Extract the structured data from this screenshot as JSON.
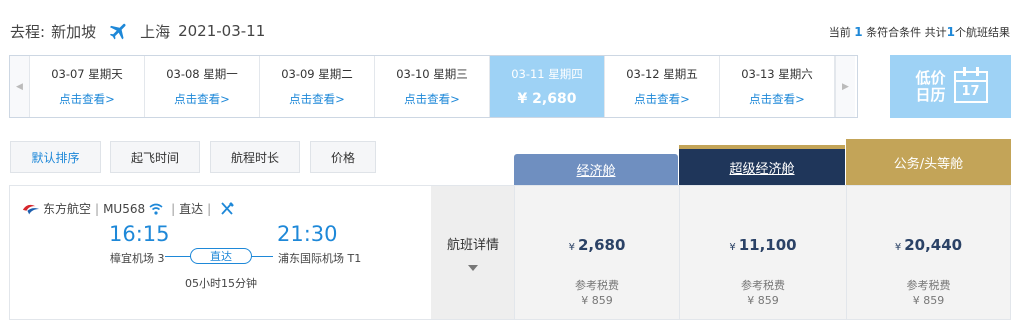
{
  "header": {
    "direction_label": "去程:",
    "from_city": "新加坡",
    "to_city": "上海",
    "date": "2021-03-11"
  },
  "result_summary": {
    "prefix": "当前",
    "match_count": "1",
    "match_text": "条符合条件 共计",
    "total_count": "1",
    "total_text": "个航班结果"
  },
  "date_strip": {
    "items": [
      {
        "date": "03-07 星期天",
        "value": "点击查看>"
      },
      {
        "date": "03-08 星期一",
        "value": "点击查看>"
      },
      {
        "date": "03-09 星期二",
        "value": "点击查看>"
      },
      {
        "date": "03-10 星期三",
        "value": "点击查看>"
      },
      {
        "date": "03-11 星期四",
        "value": "¥ 2,680"
      },
      {
        "date": "03-12 星期五",
        "value": "点击查看>"
      },
      {
        "date": "03-13 星期六",
        "value": "点击查看>"
      }
    ],
    "active_index": 4
  },
  "low_price_calendar": {
    "label": "低价日历",
    "day": "17"
  },
  "sort_buttons": [
    "默认排序",
    "起飞时间",
    "航程时长",
    "价格"
  ],
  "cabins": {
    "economy": "经济舱",
    "super_economy": "超级经济舱",
    "business": "公务/头等舱"
  },
  "flight": {
    "airline": "东方航空",
    "flight_no": "MU568",
    "direct_tag": "直达",
    "dep_time": "16:15",
    "dep_airport": "樟宜机场 3",
    "arr_time": "21:30",
    "arr_airport": "浦东国际机场 T1",
    "stop_label": "直达",
    "duration": "05小时15分钟",
    "details_label": "航班详情"
  },
  "prices": [
    {
      "currency": "¥",
      "amount": "2,680",
      "tax_label": "参考税费",
      "tax": "¥ 859"
    },
    {
      "currency": "¥",
      "amount": "11,100",
      "tax_label": "参考税费",
      "tax": "¥ 859"
    },
    {
      "currency": "¥",
      "amount": "20,440",
      "tax_label": "参考税费",
      "tax": "¥ 859"
    }
  ],
  "colors": {
    "accent_blue": "#1e88d8",
    "active_date_bg": "#9ed2f5",
    "economy_header": "#6f8fc0",
    "super_economy_header": "#1f365a",
    "business_header": "#c3a458"
  },
  "icons": {
    "plane": "airplane-icon",
    "calendar": "calendar-icon",
    "wifi": "wifi-icon",
    "meal": "meal-icon",
    "airline_logo": "china-eastern-logo"
  }
}
